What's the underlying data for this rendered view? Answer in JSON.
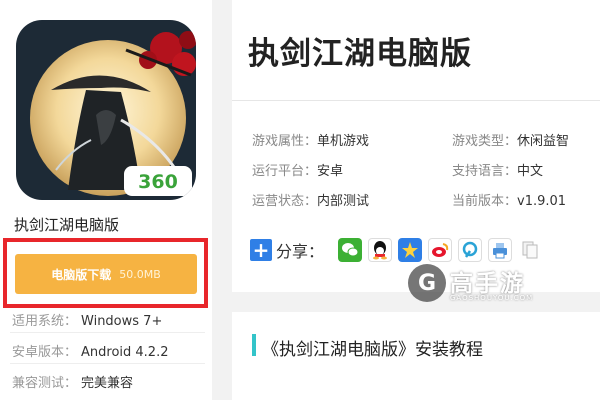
{
  "app": {
    "name": "执剑江湖电脑版",
    "icon_badge": "360",
    "download_label": "电脑版下载",
    "download_size": "50.0MB"
  },
  "specs": [
    {
      "key": "适用系统：",
      "value": "Windows 7+"
    },
    {
      "key": "安卓版本：",
      "value": "Android 4.2.2"
    },
    {
      "key": "兼容测试：",
      "value": "完美兼容"
    }
  ],
  "detail": {
    "title": "执剑江湖电脑版",
    "attributes": [
      {
        "key": "游戏属性：",
        "value": "单机游戏"
      },
      {
        "key": "游戏类型：",
        "value": "休闲益智"
      },
      {
        "key": "运行平台：",
        "value": "安卓"
      },
      {
        "key": "支持语言：",
        "value": "中文"
      },
      {
        "key": "运营状态：",
        "value": "内部测试"
      },
      {
        "key": "当前版本：",
        "value": "v1.9.01"
      }
    ],
    "share_plus": "+",
    "share_label": "分享：",
    "share_icons": [
      "wechat-icon",
      "qq-icon",
      "qzone-icon",
      "weibo-icon",
      "tencent-weibo-icon",
      "print-icon",
      "copy-icon"
    ]
  },
  "watermark": {
    "logo_glyph": "G",
    "text": "高手游",
    "sub": "GAOSHOUYOU.COM"
  },
  "tutorial": {
    "title": "《执剑江湖电脑版》安装教程"
  },
  "colors": {
    "download_button": "#f6b342",
    "highlight_frame": "#e8262b",
    "share_blue": "#2f7fe6",
    "accent_bar": "#33c4c9"
  }
}
